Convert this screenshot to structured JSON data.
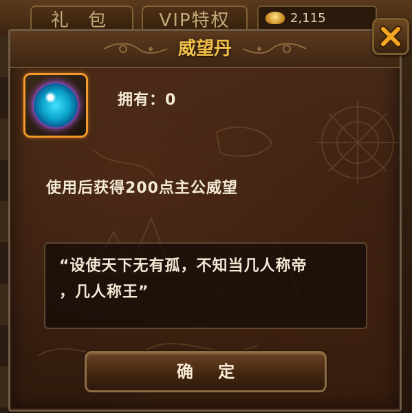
{
  "background": {
    "tabs": [
      "礼 包",
      "VIP特权"
    ],
    "gold_amount": "2,115"
  },
  "dialog": {
    "title": "威望丹",
    "owned": "拥有：0",
    "description": "使用后获得200点主公威望",
    "quote_line1": "“设使天下无有孤，不知当几人称帝",
    "quote_line2": "，几人称王”",
    "confirm_label": "确 定"
  },
  "icons": {
    "close": "close-x-icon",
    "item": "prestige-pill-orb-icon",
    "gold": "gold-ingot-icon"
  },
  "colors": {
    "title": "#f2c14a",
    "text": "#f3ead6",
    "item_frame": "#f59a2a",
    "close_x": "#f5a623"
  }
}
